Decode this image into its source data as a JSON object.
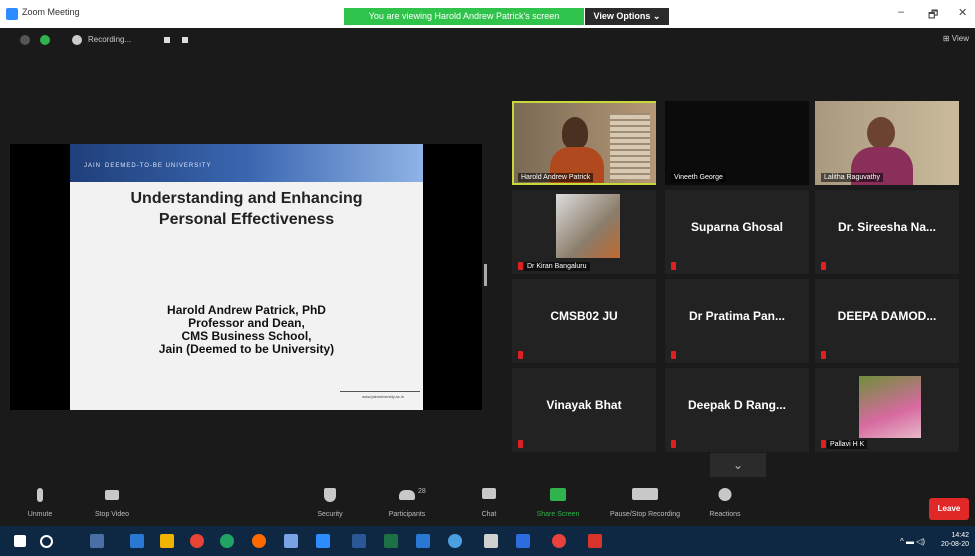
{
  "window": {
    "title": "Zoom Meeting",
    "share_banner": "You are viewing Harold Andrew Patrick's screen",
    "view_options": "View Options ⌄",
    "controls": {
      "minimize": "–",
      "maximize": "🗗",
      "close": "✕"
    }
  },
  "topbar": {
    "recording_label": "Recording...",
    "view_label": "⊞ View"
  },
  "slide": {
    "logo": "JAIN",
    "logo_sub": "DEEMED-TO-BE UNIVERSITY",
    "title": "Understanding and Enhancing\nPersonal Effectiveness",
    "author": "Harold Andrew Patrick, PhD\nProfessor and Dean,\nCMS Business School,\nJain (Deemed to be University)",
    "footer": "www.jainuniversity.ac.in"
  },
  "participants": [
    {
      "name": "Harold Andrew Patrick",
      "type": "video",
      "active": true
    },
    {
      "name": "Vineeth George",
      "type": "blank"
    },
    {
      "name": "Lalitha Raguvathy",
      "type": "video"
    },
    {
      "name": "Dr Kiran Bangaluru",
      "type": "photo"
    },
    {
      "name": "Suparna Ghosal",
      "type": "name"
    },
    {
      "name": "Dr. Sireesha Na...",
      "type": "name"
    },
    {
      "name": "CMSB02 JU",
      "type": "name"
    },
    {
      "name": "Dr Pratima Pan...",
      "type": "name"
    },
    {
      "name": "DEEPA DAMOD...",
      "type": "name"
    },
    {
      "name": "Vinayak Bhat",
      "type": "name"
    },
    {
      "name": "Deepak D Rang...",
      "type": "name"
    },
    {
      "name": "Pallavi H K",
      "type": "photo"
    }
  ],
  "scroll_down": "⌄",
  "toolbar": {
    "unmute": "Unmute",
    "stop_video": "Stop Video",
    "security": "Security",
    "participants": "Participants",
    "participants_count": "28",
    "chat": "Chat",
    "share_screen": "Share Screen",
    "recording": "Pause/Stop Recording",
    "reactions": "Reactions",
    "leave": "Leave"
  },
  "taskbar": {
    "time": "14:42",
    "date": "20-08-20"
  },
  "colors": {
    "banner": "#30c34b",
    "leave": "#e02828",
    "active_border": "#c8d838",
    "taskbar": "#0e2844"
  }
}
